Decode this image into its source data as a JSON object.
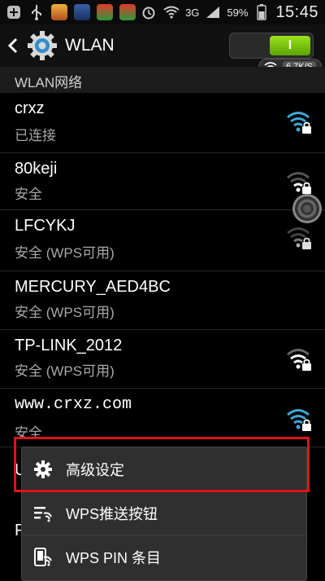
{
  "status_bar": {
    "battery_percent": "59%",
    "network_type": "3G",
    "time": "15:45",
    "icons": [
      "add-icon",
      "usb-icon",
      "app-icon",
      "app-icon",
      "app-icon",
      "app-icon",
      "alarm-icon",
      "wifi-icon",
      "signal-icon",
      "battery-icon"
    ]
  },
  "header": {
    "title": "WLAN",
    "toggle_label": "I",
    "speed": "6.7K/S"
  },
  "section": {
    "title": "WLAN网络"
  },
  "networks": [
    {
      "name": "crxz",
      "status": "已连接"
    },
    {
      "name": "80keji",
      "status": "安全"
    },
    {
      "name": "LFCYKJ",
      "status": "安全 (WPS可用)"
    },
    {
      "name": "MERCURY_AED4BC",
      "status": "安全 (WPS可用)"
    },
    {
      "name": "TP-LINK_2012",
      "status": "安全 (WPS可用)"
    },
    {
      "name": "www.crxz.com",
      "status": "安全"
    }
  ],
  "menu": {
    "items": [
      {
        "label": "高级设定",
        "icon": "gear-icon"
      },
      {
        "label": "WPS推送按钮",
        "icon": "wps-push-icon"
      },
      {
        "label": "WPS PIN 条目",
        "icon": "wps-pin-icon"
      }
    ]
  },
  "peek": {
    "row7_initial": "U",
    "row8_initial": "P"
  },
  "colors": {
    "accent_green": "#6cc00e",
    "highlight_red": "#e0121a",
    "wifi_blue": "#3fa8d8"
  }
}
